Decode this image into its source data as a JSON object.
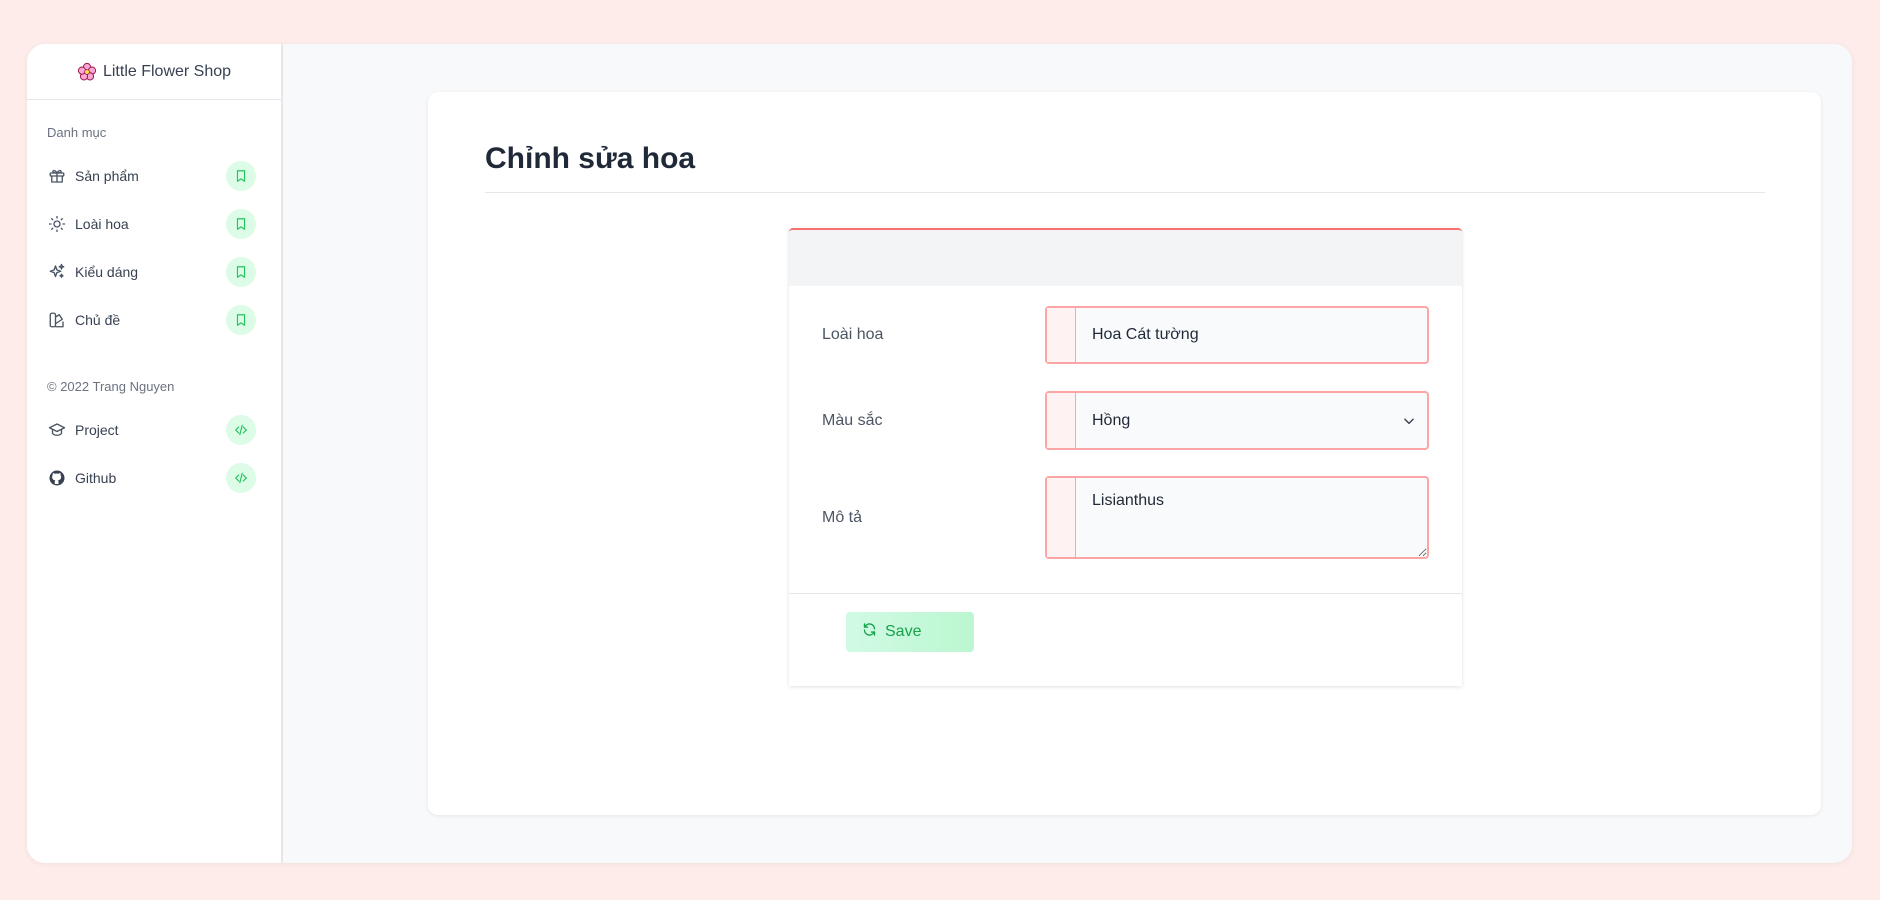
{
  "brand": {
    "icon": "flower-icon",
    "name": "Little Flower Shop"
  },
  "sidebar": {
    "section_catalog": "Danh mục",
    "items": [
      {
        "label": "Sản phẩm",
        "icon": "gift-icon",
        "badge": "bookmark-icon"
      },
      {
        "label": "Loài hoa",
        "icon": "sun-icon",
        "badge": "bookmark-icon"
      },
      {
        "label": "Kiểu dáng",
        "icon": "sparkles-icon",
        "badge": "bookmark-icon"
      },
      {
        "label": "Chủ đề",
        "icon": "swatch-icon",
        "badge": "bookmark-icon"
      }
    ],
    "copyright": "© 2022 Trang Nguyen",
    "links": [
      {
        "label": "Project",
        "icon": "academic-cap-icon",
        "badge": "code-icon"
      },
      {
        "label": "Github",
        "icon": "github-icon",
        "badge": "code-icon"
      }
    ]
  },
  "page": {
    "title": "Chỉnh sửa hoa"
  },
  "form": {
    "species_label": "Loài hoa",
    "species_value": "Hoa Cát tường",
    "color_label": "Màu sắc",
    "color_value": "Hồng",
    "description_label": "Mô tả",
    "description_value": "Lisianthus",
    "save_label": "Save"
  },
  "colors": {
    "background": "#fdecea",
    "accent_green": "#16a34a",
    "accent_red": "#f87171",
    "badge_green": "#dcfce7"
  }
}
